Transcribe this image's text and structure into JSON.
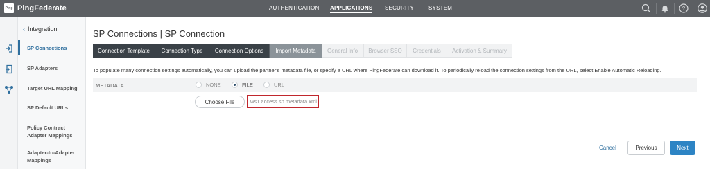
{
  "header": {
    "logo_mark": "Ping",
    "logo_text": "PingFederate",
    "nav": [
      "AUTHENTICATION",
      "APPLICATIONS",
      "SECURITY",
      "SYSTEM"
    ],
    "active_nav": "APPLICATIONS"
  },
  "sidebar": {
    "section_title": "Integration",
    "items": [
      {
        "label": "SP Connections"
      },
      {
        "label": "SP Adapters"
      },
      {
        "label": "Target URL Mapping"
      },
      {
        "label": "SP Default URLs"
      },
      {
        "label": "Policy Contract Adapter Mappings"
      },
      {
        "label": "Adapter-to-Adapter Mappings"
      }
    ],
    "active_item": "SP Connections"
  },
  "main": {
    "title": "SP Connections | SP Connection",
    "tabs": [
      {
        "label": "Connection Template",
        "state": "done"
      },
      {
        "label": "Connection Type",
        "state": "done"
      },
      {
        "label": "Connection Options",
        "state": "done"
      },
      {
        "label": "Import Metadata",
        "state": "current"
      },
      {
        "label": "General Info",
        "state": "todo"
      },
      {
        "label": "Browser SSO",
        "state": "todo"
      },
      {
        "label": "Credentials",
        "state": "todo"
      },
      {
        "label": "Activation & Summary",
        "state": "todo"
      }
    ],
    "intro": "To populate many connection settings automatically, you can upload the partner's metadata file, or specify a URL where PingFederate can download it. To periodically reload the connection settings from the URL, select Enable Automatic Reloading.",
    "metadata": {
      "label": "METADATA",
      "options": [
        "NONE",
        "FILE",
        "URL"
      ],
      "selected": "FILE"
    },
    "choose_file_label": "Choose File",
    "file_name": "ws1 access sp metadata.xml"
  },
  "footer": {
    "cancel": "Cancel",
    "previous": "Previous",
    "next": "Next"
  },
  "colors": {
    "topbar": "#5c5f63",
    "accent": "#2f6f9e",
    "next_button": "#2d84c4",
    "highlight_border": "#c0272d"
  }
}
